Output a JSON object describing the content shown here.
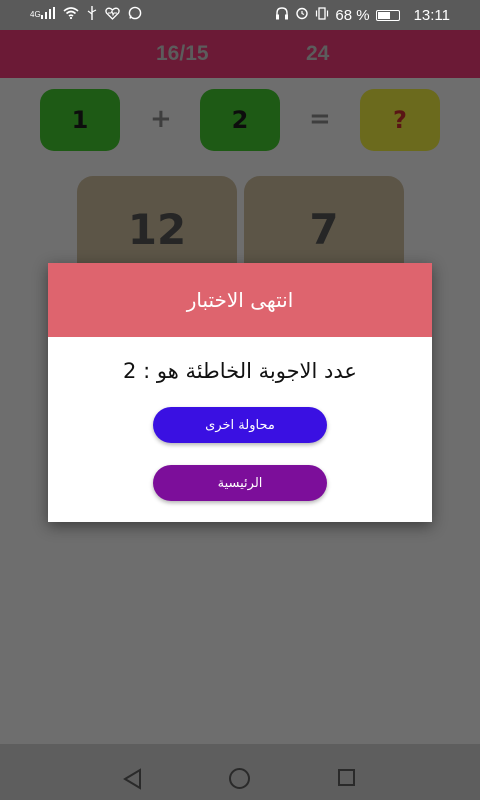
{
  "status_bar": {
    "network_label": "4G",
    "battery_percent": "68 %",
    "battery_level": 0.68,
    "time": "13:11",
    "left_icons": [
      "signal-icon",
      "wifi-icon",
      "usb-icon",
      "health-icon",
      "whatsapp-icon"
    ],
    "right_icons": [
      "headset-icon",
      "alarm-icon",
      "vibrate-icon",
      "battery-icon"
    ]
  },
  "header": {
    "progress": "16/15",
    "score": "24"
  },
  "equation": {
    "operand_a": "1",
    "operator": "+",
    "operand_b": "2",
    "equals": "=",
    "unknown": "?"
  },
  "answers": [
    "12",
    "7"
  ],
  "dialog": {
    "title": "انتهى الاختبار",
    "message": "عدد الاجوبة الخاطئة هو : 2",
    "retry_label": "محاولة اخرى",
    "home_label": "الرئيسية"
  },
  "colors": {
    "header_bg": "#6b1a36",
    "dialog_header": "#de646e",
    "retry_button": "#3a10e2",
    "home_button": "#7c0e9a",
    "operand_box": "#1e5a15",
    "unknown_box": "#6b6a1d"
  }
}
